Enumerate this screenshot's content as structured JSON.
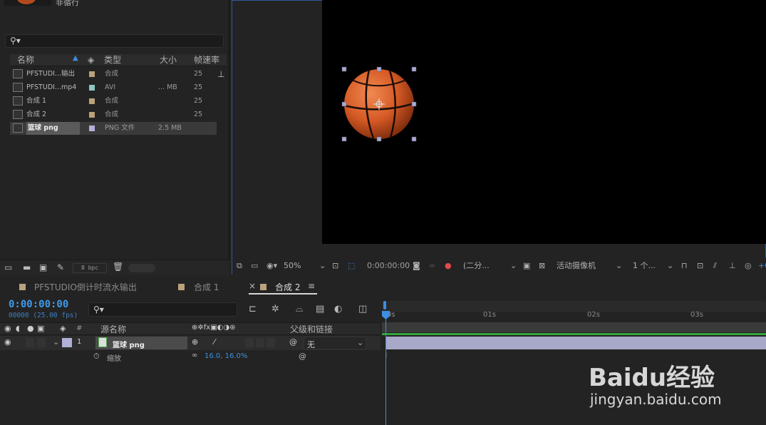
{
  "project": {
    "thumb_label": "非循行",
    "search_placeholder": "",
    "columns": {
      "name": "名称",
      "type": "类型",
      "size": "大小",
      "fps": "帧速率"
    },
    "rows": [
      {
        "name": "PFSTUDI...输出",
        "type": "合成",
        "size": "",
        "fps": "25",
        "label_color": "#b9a27c",
        "icon": "composition-icon"
      },
      {
        "name": "PFSTUDI...mp4",
        "type": "AVI",
        "size": "... MB",
        "fps": "25",
        "label_color": "#8fc6c4",
        "icon": "video-file-icon"
      },
      {
        "name": "合成 1",
        "type": "合成",
        "size": "",
        "fps": "25",
        "label_color": "#b9a27c",
        "icon": "composition-icon"
      },
      {
        "name": "合成 2",
        "type": "合成",
        "size": "",
        "fps": "25",
        "label_color": "#b9a27c",
        "icon": "composition-icon"
      },
      {
        "name": "篮球 png",
        "type": "PNG 文件",
        "size": "2.5 MB",
        "fps": "",
        "label_color": "#b0b0d8",
        "icon": "image-file-icon"
      }
    ],
    "bpc": "8 bpc"
  },
  "viewer": {
    "zoom": "50%",
    "timecode": "0:00:00:00",
    "resolution": "(二分...",
    "camera": "活动摄像机",
    "views": "1 个...",
    "extra": "+0"
  },
  "timeline": {
    "tabs": [
      {
        "label": "PFSTUDIO倒计时流水输出",
        "color": "#b9a27c"
      },
      {
        "label": "合成 1",
        "color": "#b9a27c"
      },
      {
        "label": "合成 2",
        "color": "#b9a27c"
      }
    ],
    "close": "×",
    "menu": "≡",
    "timecode": "0:00:00:00",
    "frames": "00000 (25.00 fps)",
    "col_source": "源名称",
    "col_parent": "父级和链接",
    "col_num": "#",
    "layer": {
      "num": "1",
      "name": "篮球 png",
      "parent": "无",
      "label_color": "#b0b0d8"
    },
    "prop": {
      "name": "缩放",
      "value": "16.0, 16.0%"
    },
    "ruler": [
      "0s",
      "01s",
      "02s",
      "03s"
    ]
  },
  "watermark": {
    "brand": "Baidu经验",
    "url": "jingyan.baidu.com"
  }
}
